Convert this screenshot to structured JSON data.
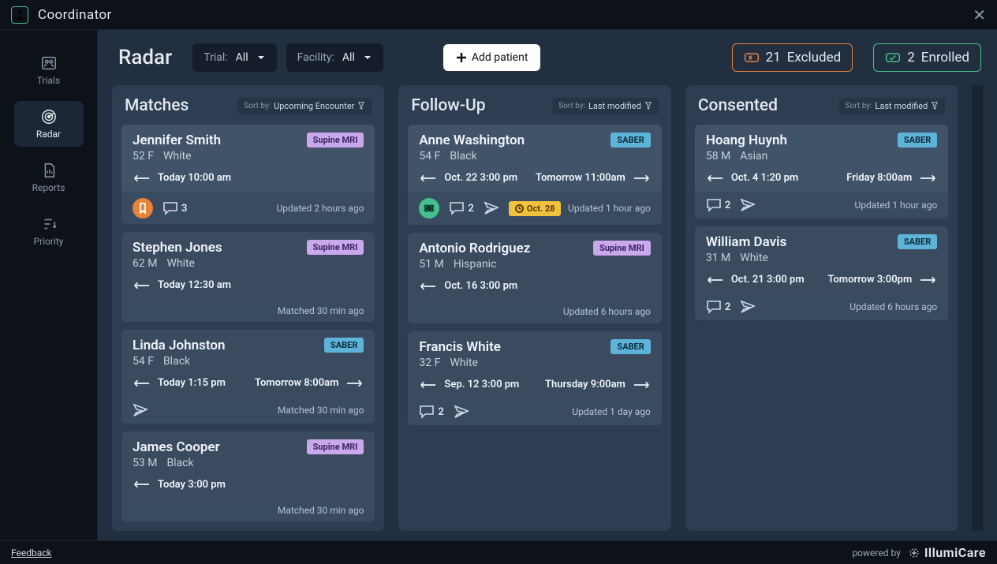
{
  "app": {
    "title": "Coordinator"
  },
  "nav": {
    "trials": {
      "label": "Trials"
    },
    "radar": {
      "label": "Radar"
    },
    "reports": {
      "label": "Reports"
    },
    "priority": {
      "label": "Priority"
    }
  },
  "header": {
    "page_title": "Radar",
    "trial_dd": {
      "label": "Trial:",
      "value": "All"
    },
    "facility_dd": {
      "label": "Facility:",
      "value": "All"
    },
    "add_patient": "Add patient",
    "excluded": {
      "count": "21",
      "label": "Excluded"
    },
    "enrolled": {
      "count": "2",
      "label": "Enrolled"
    }
  },
  "columns": {
    "matches": {
      "title": "Matches",
      "sort_label": "Sort by:",
      "sort_value": "Upcoming Encounter"
    },
    "followup": {
      "title": "Follow-Up",
      "sort_label": "Sort by:",
      "sort_value": "Last modified"
    },
    "consented": {
      "title": "Consented",
      "sort_label": "Sort by:",
      "sort_value": "Last modified"
    }
  },
  "cards": {
    "m0": {
      "name": "Jennifer Smith",
      "age_sex": "52 F",
      "race": "White",
      "badge": "Supine MRI",
      "prev": "Today 10:00 am",
      "next": "",
      "comments": "3",
      "status": "Updated  2 hours ago"
    },
    "m1": {
      "name": "Stephen Jones",
      "age_sex": "62 M",
      "race": "White",
      "badge": "Supine MRI",
      "prev": "Today 12:30 am",
      "next": "",
      "comments": "",
      "status": "Matched  30 min ago"
    },
    "m2": {
      "name": "Linda Johnston",
      "age_sex": "54 F",
      "race": "Black",
      "badge": "SABER",
      "prev": "Today 1:15 pm",
      "next": "Tomorrow 8:00am",
      "comments": "",
      "status": "Matched  30 min ago"
    },
    "m3": {
      "name": "James Cooper",
      "age_sex": "53 M",
      "race": "Black",
      "badge": "Supine MRI",
      "prev": "Today 3:00 pm",
      "next": "",
      "comments": "",
      "status": "Matched  30 min ago"
    },
    "f0": {
      "name": "Anne Washington",
      "age_sex": "54 F",
      "race": "Black",
      "badge": "SABER",
      "prev": "Oct. 22 3:00 pm",
      "next": "Tomorrow 11:00am",
      "comments": "2",
      "status": "Updated  1 hour ago",
      "due": "Oct. 28"
    },
    "f1": {
      "name": "Antonio Rodriguez",
      "age_sex": "51 M",
      "race": "Hispanic",
      "badge": "Supine MRI",
      "prev": "Oct. 16 3:00 pm",
      "next": "",
      "comments": "",
      "status": "Updated 6 hours ago"
    },
    "f2": {
      "name": "Francis White",
      "age_sex": "32 F",
      "race": "White",
      "badge": "SABER",
      "prev": "Sep. 12 3:00 pm",
      "next": "Thursday 9:00am",
      "comments": "2",
      "status": "Updated  1 day ago"
    },
    "c0": {
      "name": "Hoang Huynh",
      "age_sex": "58 M",
      "race": "Asian",
      "badge": "SABER",
      "prev": "Oct. 4 1:20 pm",
      "next": "Friday 8:00am",
      "comments": "2",
      "status": "Updated  1 hour ago"
    },
    "c1": {
      "name": "William Davis",
      "age_sex": "31 M",
      "race": "White",
      "badge": "SABER",
      "prev": "Oct. 21 3:00 pm",
      "next": "Tomorrow 3:00pm",
      "comments": "2",
      "status": "Updated  6 hours ago"
    }
  },
  "footer": {
    "feedback": "Feedback",
    "powered_by": "powered by",
    "brand": "IllumiCare"
  }
}
